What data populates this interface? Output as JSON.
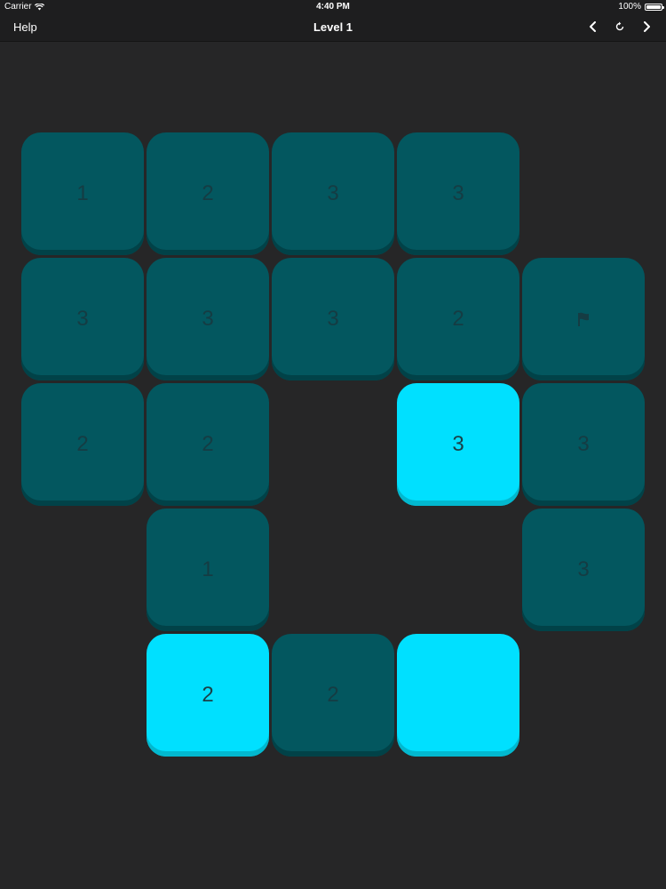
{
  "status": {
    "carrier": "Carrier",
    "time": "4:40 PM",
    "battery": "100%"
  },
  "nav": {
    "help": "Help",
    "title": "Level 1",
    "icons": [
      "chevron-left-icon",
      "restart-icon",
      "chevron-right-icon"
    ]
  },
  "colors": {
    "background": "#262627",
    "tile_dark": "#03575f",
    "tile_light": "#00e0ff",
    "text_dark": "#153c43"
  },
  "board": {
    "rows": [
      [
        {
          "v": "1",
          "state": "dark"
        },
        {
          "v": "2",
          "state": "dark"
        },
        {
          "v": "3",
          "state": "dark"
        },
        {
          "v": "3",
          "state": "dark"
        },
        null
      ],
      [
        {
          "v": "3",
          "state": "dark"
        },
        {
          "v": "3",
          "state": "dark"
        },
        {
          "v": "3",
          "state": "dark"
        },
        {
          "v": "2",
          "state": "dark"
        },
        {
          "v": "",
          "state": "dark",
          "icon": "flag-icon"
        }
      ],
      [
        {
          "v": "2",
          "state": "dark"
        },
        {
          "v": "2",
          "state": "dark"
        },
        null,
        {
          "v": "3",
          "state": "light"
        },
        {
          "v": "3",
          "state": "dark"
        }
      ],
      [
        null,
        {
          "v": "1",
          "state": "dark"
        },
        null,
        null,
        {
          "v": "3",
          "state": "dark"
        }
      ],
      [
        null,
        {
          "v": "2",
          "state": "light"
        },
        {
          "v": "2",
          "state": "dark"
        },
        {
          "v": "",
          "state": "light"
        },
        null
      ]
    ]
  }
}
